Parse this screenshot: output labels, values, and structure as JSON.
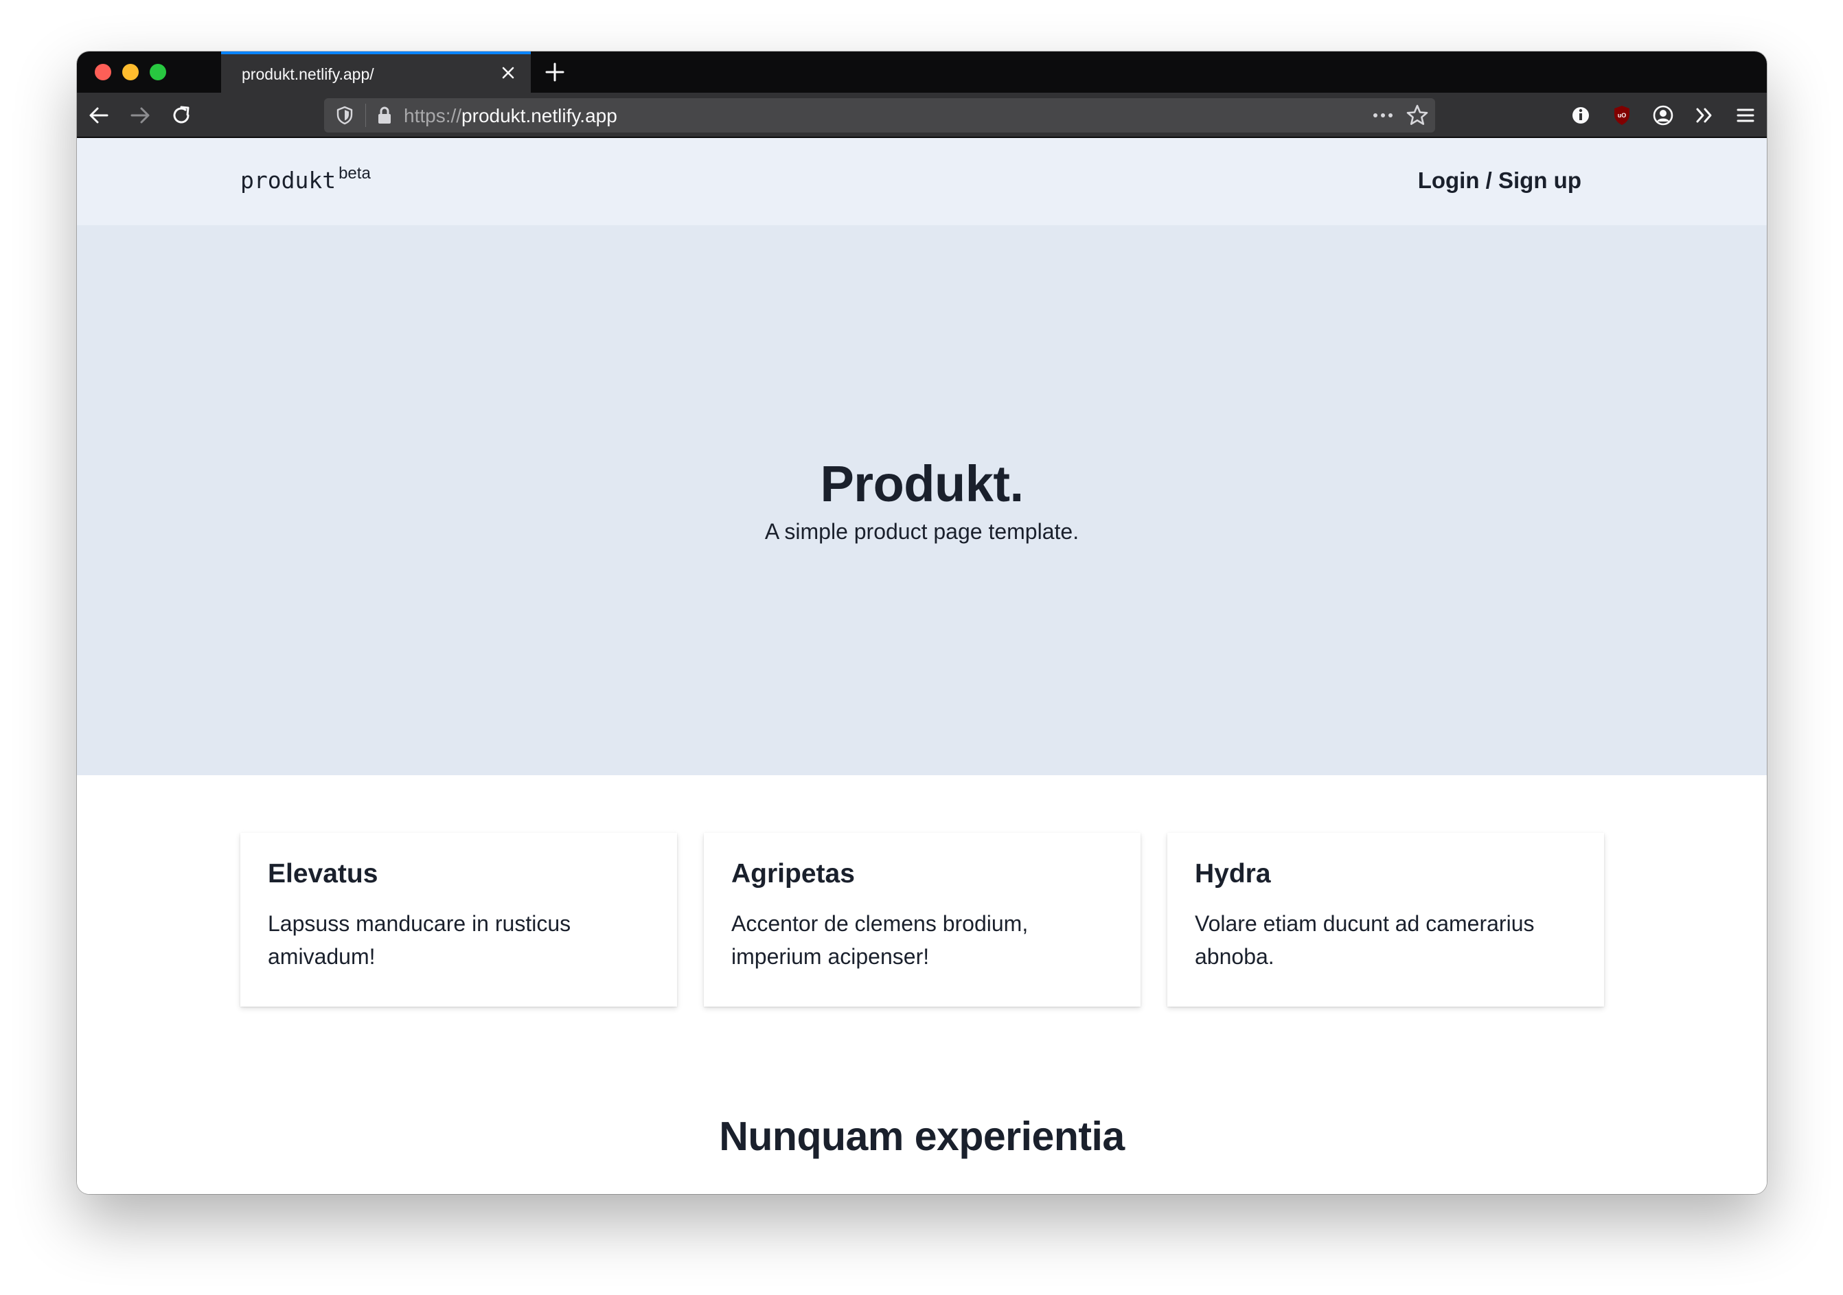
{
  "browser": {
    "tab_title": "produkt.netlify.app/",
    "url_scheme": "https://",
    "url_host": "produkt.netlify.app"
  },
  "site": {
    "brand": "produkt",
    "brand_badge": "beta",
    "login_label": "Login / Sign up"
  },
  "hero": {
    "title": "Produkt.",
    "subtitle": "A simple product page template."
  },
  "features": [
    {
      "title": "Elevatus",
      "text": "Lapsuss manducare in rusticus amivadum!"
    },
    {
      "title": "Agripetas",
      "text": "Accentor de clemens brodium, imperium acipenser!"
    },
    {
      "title": "Hydra",
      "text": "Volare etiam ducunt ad camerarius abnoba."
    }
  ],
  "section": {
    "title": "Nunquam experientia"
  }
}
